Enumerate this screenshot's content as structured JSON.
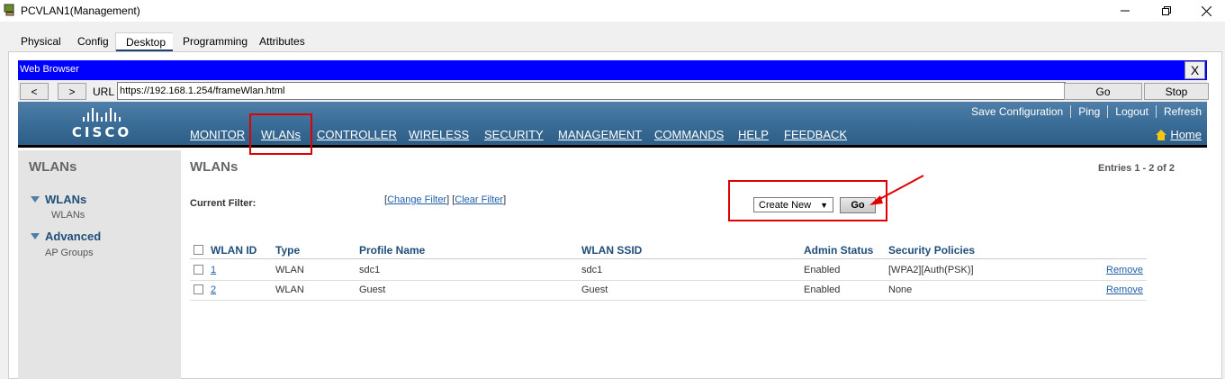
{
  "window": {
    "title": "PCVLAN1(Management)"
  },
  "pt_tabs": [
    "Physical",
    "Config",
    "Desktop",
    "Programming",
    "Attributes"
  ],
  "browser": {
    "title": "Web Browser",
    "close": "X",
    "back": "<",
    "forward": ">",
    "url_label": "URL",
    "url": "https://192.168.1.254/frameWlan.html",
    "go": "Go",
    "stop": "Stop"
  },
  "cisco": {
    "logo_text": "CISCO",
    "menu": [
      "MONITOR",
      "WLANs",
      "CONTROLLER",
      "WIRELESS",
      "SECURITY",
      "MANAGEMENT",
      "COMMANDS",
      "HELP",
      "FEEDBACK"
    ],
    "top_links": [
      "Save Configuration",
      "Ping",
      "Logout",
      "Refresh"
    ],
    "home": "Home"
  },
  "sidebar": {
    "heading": "WLANs",
    "section1": "WLANs",
    "section1_sub": "WLANs",
    "section2": "Advanced",
    "section2_sub": "AP Groups"
  },
  "main": {
    "title": "WLANs",
    "entries": "Entries 1 - 2 of 2",
    "filter_label": "Current Filter:",
    "change_filter": "Change Filter",
    "clear_filter": "Clear Filter",
    "create_select": "Create New",
    "go": "Go"
  },
  "table": {
    "headers": [
      "WLAN ID",
      "Type",
      "Profile Name",
      "WLAN SSID",
      "Admin Status",
      "Security Policies"
    ],
    "rows": [
      {
        "id": "1",
        "type": "WLAN",
        "profile": "sdc1",
        "ssid": "sdc1",
        "status": "Enabled",
        "security": "[WPA2][Auth(PSK)]",
        "action": "Remove"
      },
      {
        "id": "2",
        "type": "WLAN",
        "profile": "Guest",
        "ssid": "Guest",
        "status": "Enabled",
        "security": "None",
        "action": "Remove"
      }
    ]
  },
  "colors": {
    "browser_titlebar": "#0000ff",
    "cisco_header": "#3a6d97",
    "annotation": "#e00000",
    "link": "#1f5fa8"
  }
}
